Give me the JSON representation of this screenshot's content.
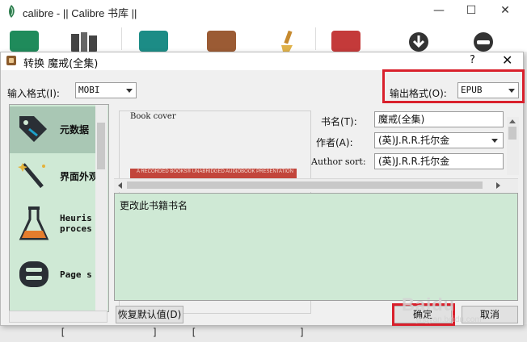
{
  "main_window": {
    "title": "calibre - || Calibre 书库 ||",
    "controls": {
      "minimize": "—",
      "maximize": "☐",
      "close": "✕"
    },
    "toolbar_colors": {
      "green": "#1f8b5b",
      "teal": "#1c8c86",
      "brown": "#9b5b34",
      "red": "#c43a3a",
      "dark": "#333333"
    },
    "status_fragments": [
      "[",
      "]",
      "[",
      "]"
    ]
  },
  "dialog": {
    "title": "转换 魔戒(全集)",
    "help": "?",
    "close": "✕",
    "input_format_label": "输入格式(I):",
    "input_format_value": "MOBI",
    "output_format_label": "输出格式(O):",
    "output_format_value": "EPUB",
    "highlight_color": "#d9202c"
  },
  "sidebar": {
    "items": [
      {
        "label": "元数据",
        "icon": "metadata-tag-icon",
        "selected": true
      },
      {
        "label": "界面外观",
        "icon": "magic-wand-icon",
        "selected": false
      },
      {
        "label": "Heuris\nproces",
        "icon": "flask-icon",
        "selected": false
      },
      {
        "label": "Page s",
        "icon": "toggle-icon",
        "selected": false
      }
    ],
    "background": "#cfe9d5",
    "selected_background": "#a9c7b4"
  },
  "metadata": {
    "cover_label": "Book cover",
    "cover_text": "A RECORDED BOOKS® UNABRIDGED AUDIOBOOK PRESENTATION",
    "title_label": "书名(T):",
    "title_value": "魔戒(全集)",
    "author_label": "作者(A):",
    "author_value": "(英)J.R.R.托尔金",
    "author_sort_label": "Author sort:",
    "author_sort_value": "(英)J.R.R.托尔金"
  },
  "help_text": "更改此书籍书名",
  "buttons": {
    "restore_defaults": "恢复默认值(D)",
    "ok": "确定",
    "cancel": "取消"
  },
  "watermark": {
    "brand": "Baidu",
    "sub": "jingyan.baidu.com"
  }
}
